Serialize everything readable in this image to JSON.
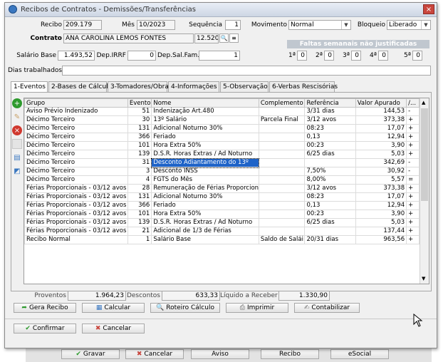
{
  "window": {
    "title": "Recibos de Contratos - Demissões/Transferências",
    "close_glyph": "×"
  },
  "header": {
    "recibo_label": "Recibo",
    "recibo_value": "209.179",
    "mes_label": "Mês",
    "mes_value": "10/2023",
    "sequencia_label": "Sequência",
    "sequencia_value": "1",
    "movimento_label": "Movimento",
    "movimento_value": "Normal",
    "bloqueio_label": "Bloqueio",
    "bloqueio_value": "Liberado",
    "contrato_label": "Contrato",
    "contrato_value": "ANA CAROLINA LEMOS FONTES",
    "contrato_code": "12.520",
    "faltas_title": "Faltas semanais não justificadas",
    "salario_label": "Salário Base",
    "salario_value": "1.493,52",
    "dep_irrf_label": "Dep.IRRF",
    "dep_irrf_value": "0",
    "dep_salfam_label": "Dep.Sal.Fam.",
    "dep_salfam_value": "1",
    "semanas": [
      {
        "label": "1ª",
        "value": "0"
      },
      {
        "label": "2ª",
        "value": "0"
      },
      {
        "label": "3ª",
        "value": "0"
      },
      {
        "label": "4ª",
        "value": "0"
      },
      {
        "label": "5ª",
        "value": "0"
      }
    ],
    "dias_label": "Dias trabalhados",
    "dias_value": ""
  },
  "tabs": [
    {
      "label": "1-Eventos"
    },
    {
      "label": "2-Bases de Cálculo"
    },
    {
      "label": "3-Tomadores/Obras"
    },
    {
      "label": "4-Informações"
    },
    {
      "label": "5-Observação"
    },
    {
      "label": "6-Verbas Rescisórias"
    }
  ],
  "grid": {
    "columns": [
      "Grupo",
      "Evento",
      "Nome",
      "Complemento",
      "Referência",
      "Valor Apurado",
      "/..."
    ],
    "rows": [
      [
        "Aviso Prévio Indenizado",
        "51",
        "Indenização Art.480",
        "",
        "3/31 dias",
        "144,53",
        "-"
      ],
      [
        "Décimo Terceiro",
        "30",
        "13º Salário",
        "Parcela Final",
        "3/12 avos",
        "373,38",
        "+"
      ],
      [
        "Décimo Terceiro",
        "131",
        "Adicional Noturno 30%",
        "",
        "08:23",
        "17,07",
        "+"
      ],
      [
        "Décimo Terceiro",
        "366",
        "Feriado",
        "",
        "0,13",
        "12,94",
        "+"
      ],
      [
        "Décimo Terceiro",
        "101",
        "Hora Extra 50%",
        "",
        "00:23",
        "3,90",
        "+"
      ],
      [
        "Décimo Terceiro",
        "139",
        "D.S.R. Horas Extras / Ad Noturno",
        "",
        "6/25 dias",
        "5,03",
        "+"
      ],
      [
        "Décimo Terceiro",
        "31",
        "Desconto Adiantamento do 13º",
        "",
        "",
        "342,69",
        "-"
      ],
      [
        "Décimo Terceiro",
        "3",
        "Desconto INSS",
        "",
        "7,50%",
        "30,92",
        "-"
      ],
      [
        "Décimo Terceiro",
        "4",
        "FGTS do Mês",
        "",
        "8,00%",
        "5,57",
        "="
      ],
      [
        "Férias Proporcionais - 03/12 avos",
        "28",
        "Remuneração de Férias Proporcionais",
        "",
        "3/12 avos",
        "373,38",
        "+"
      ],
      [
        "Férias Proporcionais - 03/12 avos",
        "131",
        "Adicional Noturno 30%",
        "",
        "08:23",
        "17,07",
        "+"
      ],
      [
        "Férias Proporcionais - 03/12 avos",
        "366",
        "Feriado",
        "",
        "0,13",
        "12,94",
        "+"
      ],
      [
        "Férias Proporcionais - 03/12 avos",
        "101",
        "Hora Extra 50%",
        "",
        "00:23",
        "3,90",
        "+"
      ],
      [
        "Férias Proporcionais - 03/12 avos",
        "139",
        "D.S.R. Horas Extras / Ad Noturno",
        "",
        "6/25 dias",
        "5,03",
        "+"
      ],
      [
        "Férias Proporcionais - 03/12 avos",
        "21",
        "Adicional de 1/3 de Férias",
        "",
        "",
        "137,44",
        "+"
      ],
      [
        "Recibo Normal",
        "1",
        "Salário Base",
        "Saldo de Salái",
        "20/31 dias",
        "963,56",
        "+"
      ]
    ]
  },
  "totals": {
    "proventos_label": "Proventos",
    "proventos_value": "1.964,23",
    "descontos_label": "Descontos",
    "descontos_value": "633,33",
    "liquido_label": "Líquido a Receber",
    "liquido_value": "1.330,90"
  },
  "actions": {
    "gera_recibo": "Gera Recibo",
    "calcular": "Calcular",
    "roteiro": "Roteiro Cálculo",
    "imprimir": "Imprimir",
    "contabilizar": "Contabilizar",
    "confirmar": "Confirmar",
    "cancelar": "Cancelar"
  },
  "bottom_bar": {
    "gravar": "Gravar",
    "cancelar": "Cancelar",
    "aviso": "Aviso",
    "recibo": "Recibo",
    "esocial": "eSocial"
  },
  "colors": {
    "selection": "#1e63c8",
    "close": "#c9463d",
    "faltas_bg": "#c0c7cf"
  }
}
